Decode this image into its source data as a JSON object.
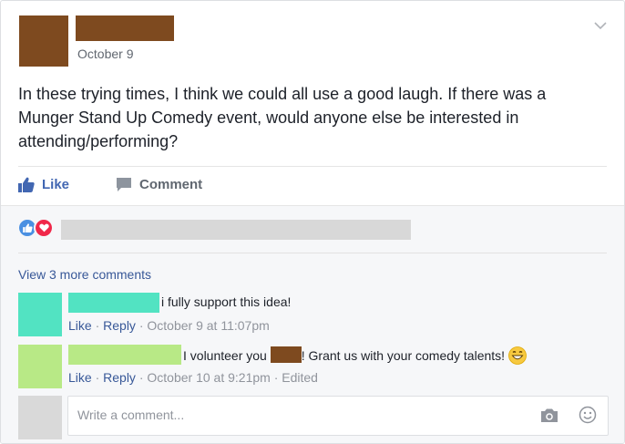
{
  "post": {
    "date": "October 9",
    "text": "In these trying times, I think we could all use a good laugh. If there was a Munger Stand Up Comedy event, would anyone else be interested in attending/performing?",
    "colors": {
      "redaction": "#7e4a1f",
      "link": "#385898",
      "like_blue": "#4267b2"
    }
  },
  "actions": {
    "like_label": "Like",
    "comment_label": "Comment"
  },
  "feedback": {
    "view_more": "View 3 more comments",
    "comments": [
      {
        "avatar_color": "#52e3c2",
        "text": "i fully support this idea!",
        "like": "Like",
        "reply": "Reply",
        "timestamp": "October 9 at 11:07pm"
      },
      {
        "avatar_color": "#b8e986",
        "text_before": "I volunteer you ",
        "text_after": "! Grant us with your comedy talents!",
        "like": "Like",
        "reply": "Reply",
        "timestamp": "October 10 at 9:21pm",
        "edited": "Edited"
      }
    ],
    "reply_placeholder": "Write a comment..."
  }
}
